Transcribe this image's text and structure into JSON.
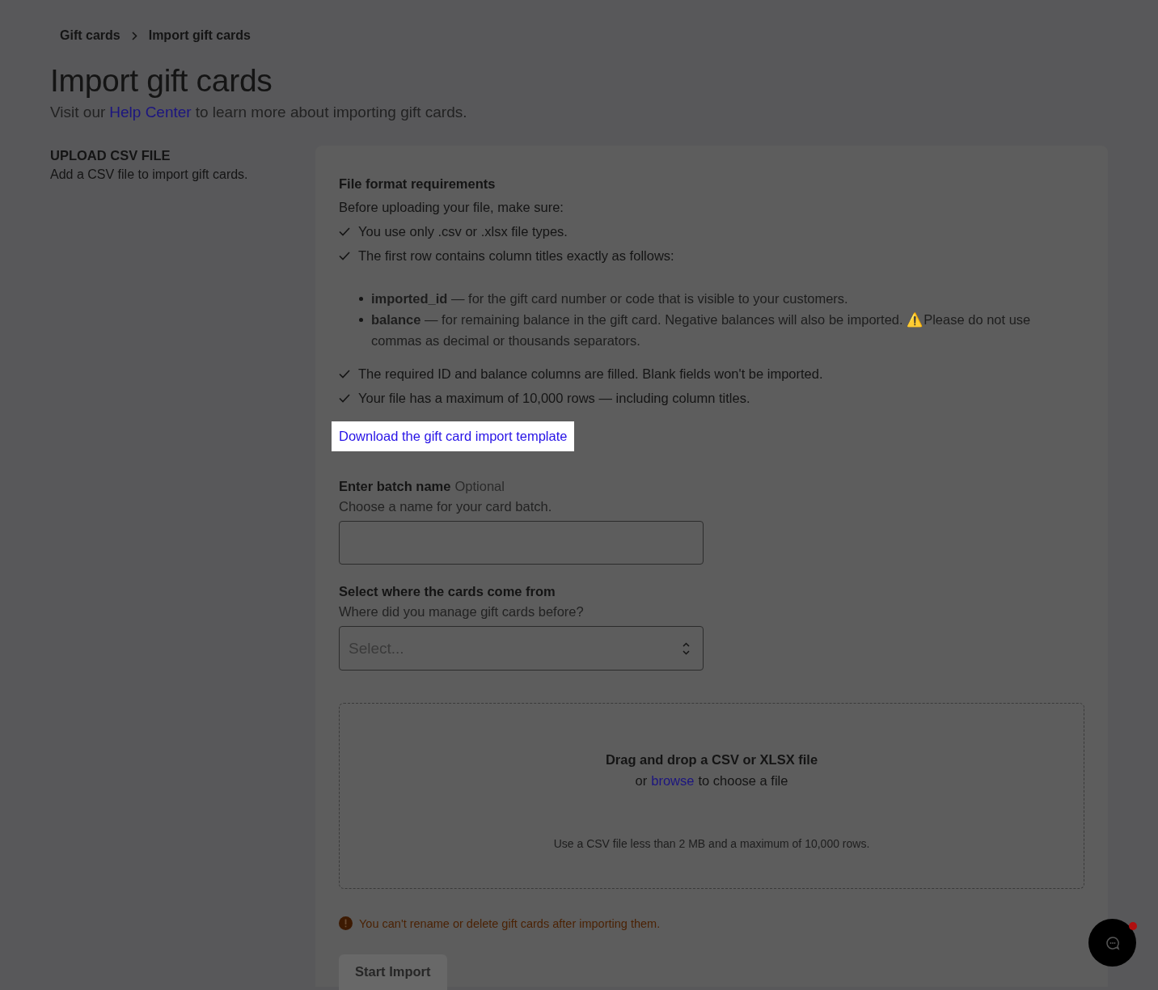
{
  "breadcrumb": [
    {
      "label": "Gift cards"
    },
    {
      "label": "Import gift cards"
    }
  ],
  "title": "Import gift cards",
  "intro": {
    "before": "Visit our",
    "link": "Help Center",
    "after": "to learn more about importing gift cards."
  },
  "section": {
    "heading": "UPLOAD CSV FILE",
    "description": "Add a CSV file to import gift cards."
  },
  "requirements": {
    "heading": "File format requirements",
    "lead": "Before uploading your file, make sure:",
    "items": [
      {
        "text": "You use only .csv or .xlsx file types."
      },
      {
        "text": "The first row contains column titles exactly as follows:",
        "children": [
          {
            "text": "**imported_id** — for the gift card number or code that is visible to your customers."
          },
          {
            "text": "**balance** — for remaining balance in the gift card. Negative balances will also be imported. ⚠️Please do not use commas as decimal or thousands separators."
          }
        ]
      },
      {
        "text": "The required ID and balance columns are filled. Blank fields won't be imported."
      },
      {
        "text": "Your file has a maximum of 10,000 rows — including column titles."
      }
    ]
  },
  "template_link": {
    "label": "Download the gift card import template",
    "highlighted": true
  },
  "batch": {
    "label": "Enter batch name",
    "optional": "Optional",
    "help": "Choose a name for your card batch."
  },
  "source": {
    "label": "Select where the cards come from",
    "help": "Where did you manage gift cards before?",
    "placeholder": "Select..."
  },
  "dropzone": {
    "title": "Drag and drop a CSV or XLSX file",
    "before": "or",
    "link": "browse",
    "after": "to choose a file",
    "limits": "Use a CSV file less than 2 MB and a maximum of 10,000 rows."
  },
  "warning": "You can't rename or delete gift cards after importing them.",
  "start_button": {
    "label": "Start Import",
    "disabled": true
  },
  "chat": {
    "unread": true
  }
}
